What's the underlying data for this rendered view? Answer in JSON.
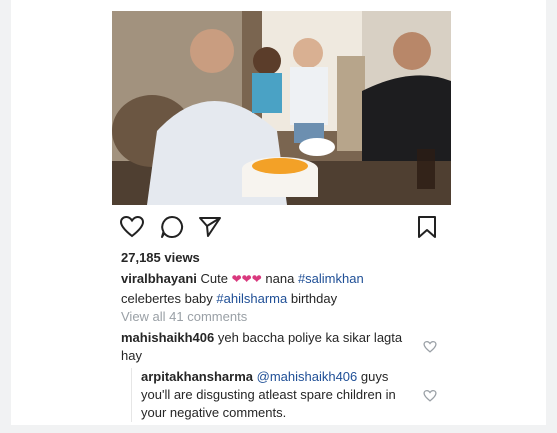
{
  "post": {
    "views": "27,185 views",
    "caption": {
      "username": "viralbhayani",
      "text_before": "Cute",
      "emoji": "❤❤❤",
      "text_mid": "nana",
      "tag1": "#salimkhan",
      "text_after": "celebertes baby",
      "tag2": "#ahilsharma",
      "text_end": "birthday"
    },
    "view_all": "View all 41 comments"
  },
  "comments": [
    {
      "username": "mahishaikh406",
      "text": "yeh baccha poliye ka sikar lagta hay"
    }
  ],
  "reply": {
    "username": "arpitakhansharma",
    "mention": "@mahishaikh406",
    "text": "guys you'll are disgusting atleast spare children in your negative comments."
  },
  "colors": {
    "hashtag": "#1f4f96",
    "heart": "#d9397e"
  }
}
